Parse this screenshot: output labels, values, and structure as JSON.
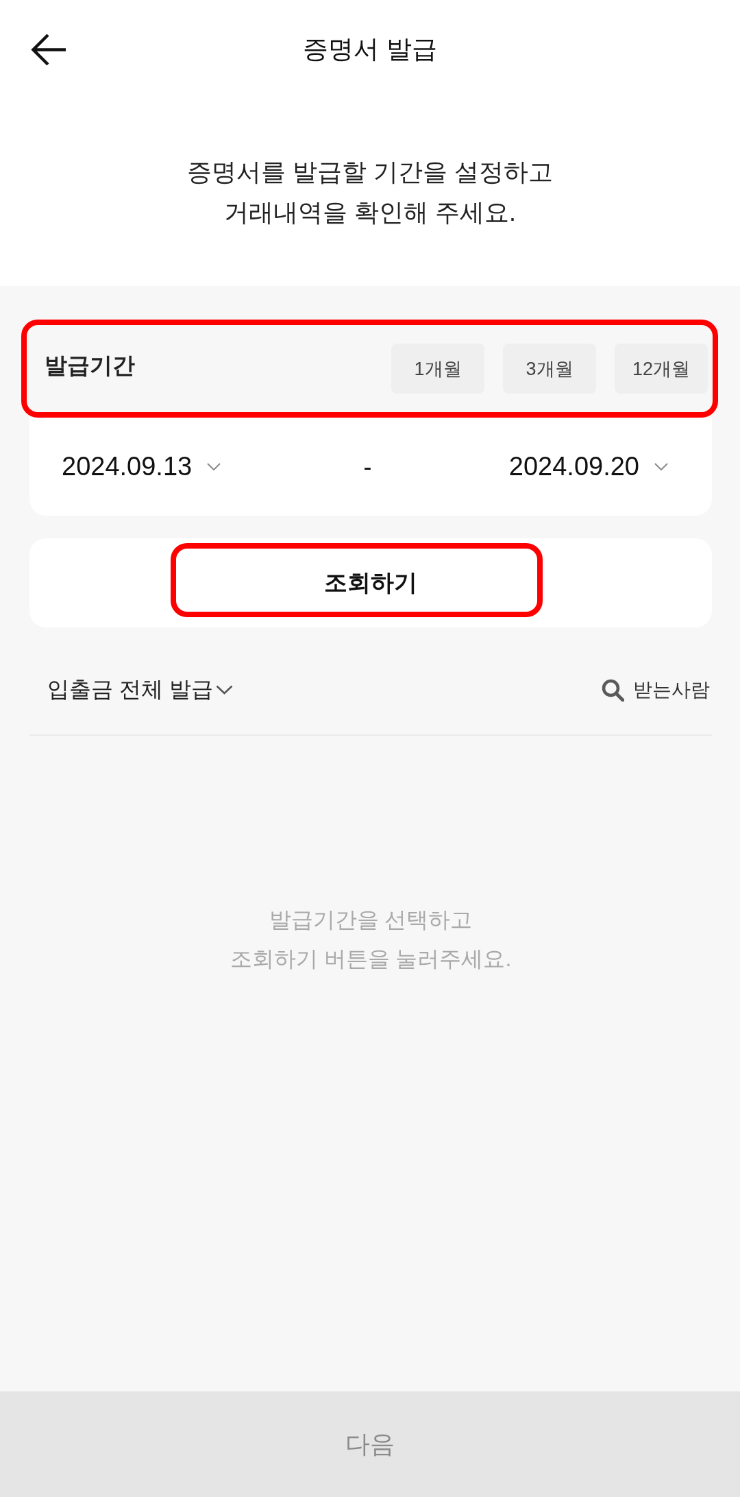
{
  "header": {
    "title": "증명서 발급"
  },
  "intro": "증명서를 발급할 기간을 설정하고\n거래내역을 확인해 주세요.",
  "period": {
    "label": "발급기간",
    "highlighted": true,
    "presets": [
      {
        "label": "1개월",
        "selected": false
      },
      {
        "label": "3개월",
        "selected": false
      },
      {
        "label": "12개월",
        "selected": false
      }
    ],
    "start_date": "2024.09.13",
    "separator": "-",
    "end_date": "2024.09.20"
  },
  "search_button": {
    "label": "조회하기",
    "highlighted": true
  },
  "filter": {
    "label": "입출금 전체 발급"
  },
  "recipient_search": {
    "label": "받는사람"
  },
  "empty_message": "발급기간을 선택하고\n조회하기 버튼을 눌러주세요.",
  "next_button": {
    "label": "다음",
    "disabled": true
  }
}
